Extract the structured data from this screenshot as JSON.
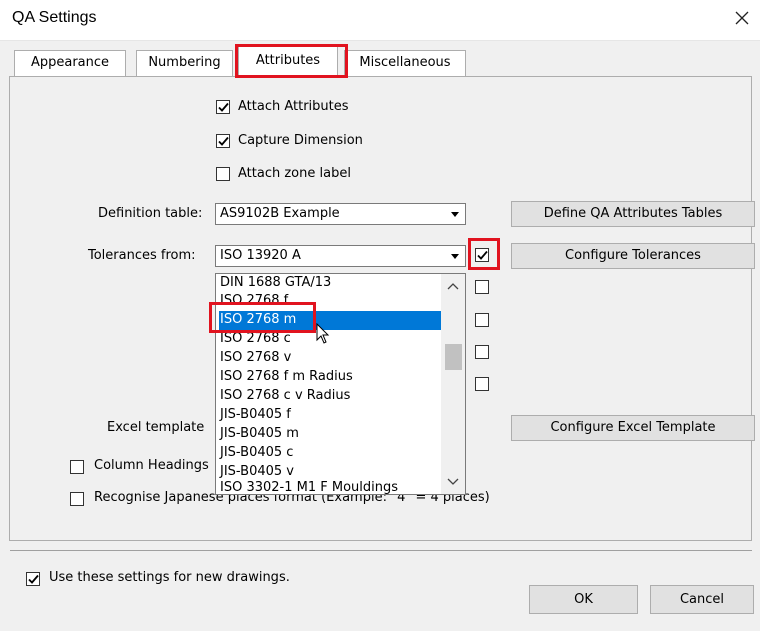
{
  "window": {
    "title": "QA Settings",
    "close_icon": "close-icon"
  },
  "tabs": [
    {
      "label": "Appearance"
    },
    {
      "label": "Numbering"
    },
    {
      "label": "Attributes",
      "selected": true
    },
    {
      "label": "Miscellaneous"
    }
  ],
  "options": {
    "attach_attributes": {
      "label": "Attach Attributes",
      "checked": true
    },
    "capture_dimension": {
      "label": "Capture Dimension",
      "checked": true
    },
    "attach_zone_label": {
      "label": "Attach zone label",
      "checked": false
    }
  },
  "definition_table": {
    "label": "Definition table:",
    "value": "AS9102B Example",
    "button": "Define QA Attributes Tables"
  },
  "tolerances": {
    "label": "Tolerances from:",
    "value": "ISO 13920 A",
    "checked": true,
    "button": "Configure Tolerances"
  },
  "dropdown_list": {
    "items": [
      "DIN 1688 GTA/13",
      "ISO 2768 f",
      "ISO 2768 m",
      "ISO 2768 c",
      "ISO 2768 v",
      "ISO 2768 f m Radius",
      "ISO 2768 c v Radius",
      "JIS-B0405 f",
      "JIS-B0405 m",
      "JIS-B0405 c",
      "JIS-B0405 v",
      "ISO 3302-1 M1 F Mouldings"
    ],
    "highlighted": "ISO 2768 m"
  },
  "excel_template": {
    "label": "Excel template",
    "button": "Configure Excel Template"
  },
  "column_headings": {
    "label": "Column Headings",
    "checked": false
  },
  "recognise_japanese": {
    "label": "Recognise Japanese places format (Example: \"4\" = 4 places)",
    "label_visible_tail": "= 4 places)",
    "checked": false
  },
  "use_for_new": {
    "label": "Use these settings for new drawings.",
    "checked": true
  },
  "footer": {
    "ok": "OK",
    "cancel": "Cancel"
  },
  "colors": {
    "highlight_red": "#e1131f",
    "selection_blue": "#0078d7",
    "dialog_bg": "#f0f0f0"
  }
}
